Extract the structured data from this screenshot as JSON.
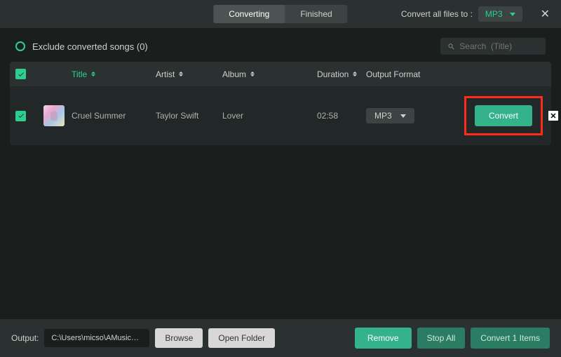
{
  "topbar": {
    "tabs": {
      "converting": "Converting",
      "finished": "Finished"
    },
    "convert_all_label": "Convert all files to :",
    "convert_all_format": "MP3"
  },
  "subbar": {
    "exclude_label": "Exclude converted songs (0)",
    "search_placeholder": "Search  (Title)"
  },
  "columns": {
    "title": "Title",
    "artist": "Artist",
    "album": "Album",
    "duration": "Duration",
    "output_format": "Output Format"
  },
  "rows": [
    {
      "title": "Cruel Summer",
      "artist": "Taylor Swift",
      "album": "Lover",
      "duration": "02:58",
      "format": "MP3",
      "convert_label": "Convert"
    }
  ],
  "bottom": {
    "output_label": "Output:",
    "path": "C:\\Users\\micso\\AMusicSoft\\...",
    "browse": "Browse",
    "open_folder": "Open Folder",
    "remove": "Remove",
    "stop_all": "Stop All",
    "convert_items": "Convert 1 Items"
  },
  "colors": {
    "accent": "#2dcf8f",
    "highlight_border": "#ff2a1a"
  }
}
